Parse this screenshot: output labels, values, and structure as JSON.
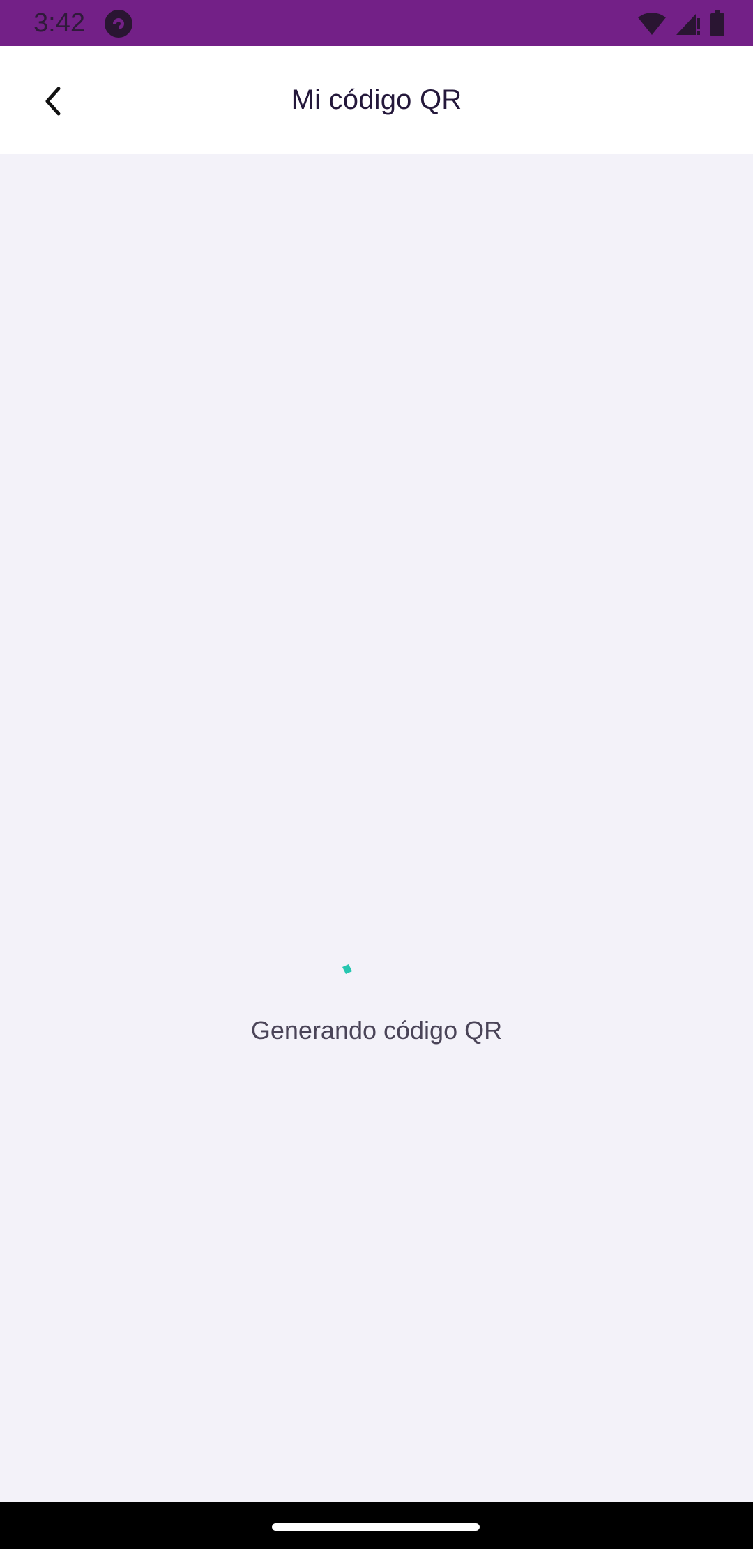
{
  "status_bar": {
    "time": "3:42",
    "colors": {
      "background": "#732087"
    },
    "icons": [
      "app-notification-icon",
      "wifi-icon",
      "signal-icon",
      "battery-icon"
    ]
  },
  "header": {
    "title": "Mi código QR",
    "back_icon": "chevron-left-icon"
  },
  "loading": {
    "message": "Generando código QR",
    "spinner_color": "#26c6b0"
  },
  "colors": {
    "page_background": "#f3f2f9",
    "app_bar_background": "#ffffff",
    "title_color": "#24183b"
  }
}
